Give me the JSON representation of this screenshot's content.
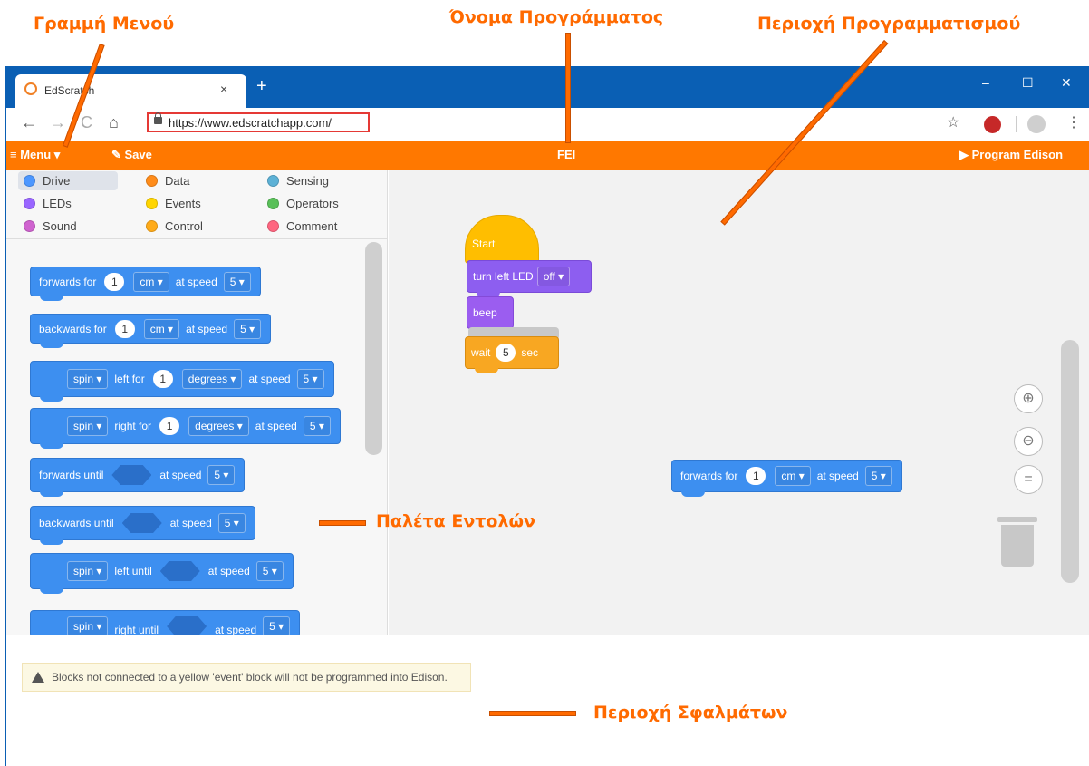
{
  "annotations": {
    "menu_bar": "Γραμμή Μενού",
    "program_name": "Όνομα Προγράμματος",
    "programming_area": "Περιοχή Προγραμματισμού",
    "command_palette": "Παλέτα Εντολών",
    "error_area": "Περιοχή Σφαλμάτων"
  },
  "browser": {
    "tab_title": "EdScratch",
    "tab_close": "×",
    "new_tab": "+",
    "url": "https://www.edscratchapp.com/",
    "win_min": "–",
    "win_max": "☐",
    "win_close": "✕",
    "back": "←",
    "forward": "→",
    "reload": "C",
    "home": "⌂",
    "star": "☆",
    "more": "⋮"
  },
  "menubar": {
    "menu_label": "≡ Menu ▾",
    "save_label": "✎ Save",
    "program_name": "FEI",
    "program_edison": "▶ Program Edison"
  },
  "categories": [
    {
      "label": "Drive",
      "color": "#4c97ff"
    },
    {
      "label": "Data",
      "color": "#ff8c1a"
    },
    {
      "label": "Sensing",
      "color": "#5cb1d6"
    },
    {
      "label": "LEDs",
      "color": "#9966ff"
    },
    {
      "label": "Events",
      "color": "#ffd500"
    },
    {
      "label": "Operators",
      "color": "#59c059"
    },
    {
      "label": "Sound",
      "color": "#cf63cf"
    },
    {
      "label": "Control",
      "color": "#ffab19"
    },
    {
      "label": "Comment",
      "color": "#ff6680"
    }
  ],
  "palette": {
    "b1": {
      "a": "forwards for",
      "v": "1",
      "u": "cm ▾",
      "s": "at speed",
      "n": "5 ▾"
    },
    "b2": {
      "a": "backwards for",
      "v": "1",
      "u": "cm ▾",
      "s": "at speed",
      "n": "5 ▾"
    },
    "b3": {
      "d": "spin ▾",
      "a": "left for",
      "v": "1",
      "u": "degrees ▾",
      "s": "at speed",
      "n": "5 ▾"
    },
    "b4": {
      "d": "spin ▾",
      "a": "right for",
      "v": "1",
      "u": "degrees ▾",
      "s": "at speed",
      "n": "5 ▾"
    },
    "b5": {
      "a": "forwards until",
      "s": "at speed",
      "n": "5 ▾"
    },
    "b6": {
      "a": "backwards until",
      "s": "at speed",
      "n": "5 ▾"
    },
    "b7": {
      "d": "spin ▾",
      "a": "left until",
      "s": "at speed",
      "n": "5 ▾"
    },
    "b8": {
      "d": "spin ▾",
      "a": "right until",
      "s": "at speed",
      "n": "5 ▾"
    }
  },
  "workspace": {
    "start": "Start",
    "led": {
      "a": "turn left LED",
      "d": "off ▾"
    },
    "beep": "beep",
    "wait": {
      "a": "wait",
      "v": "5",
      "u": "sec"
    },
    "loose": {
      "a": "forwards for",
      "v": "1",
      "u": "cm ▾",
      "s": "at speed",
      "n": "5 ▾"
    },
    "zoom_in": "⊕",
    "zoom_out": "⊖",
    "zoom_reset": "="
  },
  "error": {
    "message": "Blocks not connected to a yellow 'event' block will not be programmed into Edison."
  }
}
